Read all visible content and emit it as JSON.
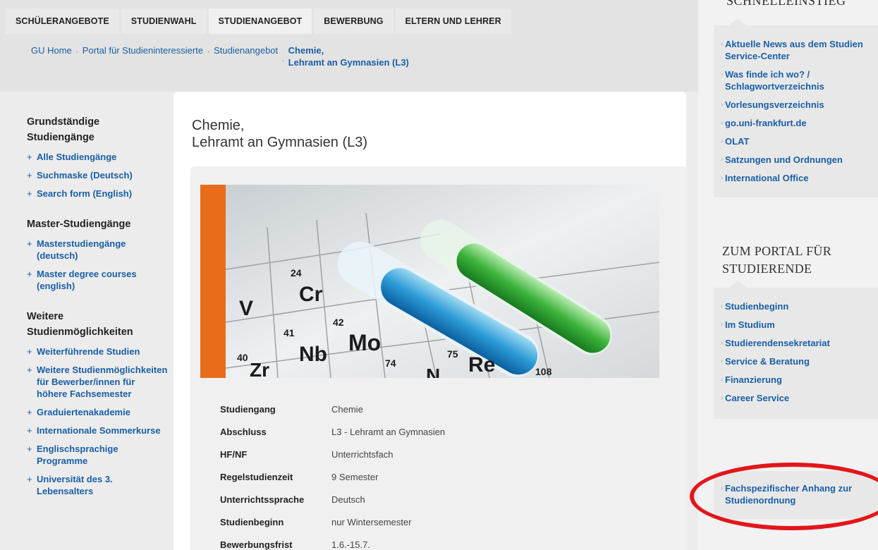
{
  "nav": {
    "tabs": [
      {
        "label": "SCHÜLERANGEBOTE"
      },
      {
        "label": "STUDIENWAHL"
      },
      {
        "label": "STUDIENANGEBOT"
      },
      {
        "label": "BEWERBUNG"
      },
      {
        "label": "ELTERN UND LEHRER"
      }
    ]
  },
  "breadcrumb": {
    "items": [
      "GU Home",
      "Portal für Studieninteressierte",
      "Studienangebot"
    ],
    "current_line1": "Chemie,",
    "current_line2": "Lehramt an Gymnasien (L3)"
  },
  "sidebar": {
    "section1": {
      "heading_line1": "Grundständige",
      "heading_line2": "Studiengänge",
      "items": [
        "Alle Studiengänge",
        "Suchmaske (Deutsch)",
        "Search form (English)"
      ]
    },
    "section2": {
      "heading": "Master-Studiengänge",
      "items": [
        "Masterstudiengänge (deutsch)",
        "Master degree courses (english)"
      ]
    },
    "section3": {
      "heading_line1": "Weitere",
      "heading_line2": "Studienmöglichkeiten",
      "items": [
        "Weiterführende Studien",
        "Weitere Studienmöglichkeiten für Bewerber/innen für höhere Fachsemester",
        "Graduiertenakademie",
        "Internationale Sommerkurse",
        "Englischsprachige Programme",
        "Universität des 3. Lebensalters"
      ]
    }
  },
  "content": {
    "title_line1": "Chemie,",
    "title_line2": "Lehramt an Gymnasien (L3)",
    "facts": [
      {
        "label": "Studiengang",
        "value": "Chemie"
      },
      {
        "label": "Abschluss",
        "value": "L3 - Lehramt an Gymnasien"
      },
      {
        "label": "HF/NF",
        "value": "Unterrichtsfach"
      },
      {
        "label": "Regelstudienzeit",
        "value": "9 Semester"
      },
      {
        "label": "Unterrichtssprache",
        "value": "Deutsch"
      },
      {
        "label": "Studienbeginn",
        "value": "nur Wintersemester"
      },
      {
        "label": "Bewerbungsfrist",
        "value": "1.6.-15.7."
      }
    ],
    "periodic_symbols": [
      "V",
      "Cr",
      "Nb",
      "Mo",
      "Zr",
      "Re",
      "N",
      "24",
      "42",
      "41",
      "40",
      "74",
      "75",
      "108"
    ]
  },
  "right": {
    "top_heading": "SCHNELLEINSTIEG",
    "quick_links": [
      "Aktuelle News aus dem Studien Service-Center",
      "Was finde ich wo? / Schlagwortverzeichnis",
      "Vorlesungsverzeichnis",
      "go.uni-frankfurt.de",
      "OLAT",
      "Satzungen und Ordnungen",
      "International Office"
    ],
    "portal_heading_line1": "ZUM PORTAL FÜR",
    "portal_heading_line2": "STUDIERENDE",
    "portal_links": [
      "Studienbeginn",
      "Im Studium",
      "Studierendensekretariat",
      "Service & Beratung",
      "Finanzierung",
      "Career Service"
    ],
    "bottom_link": "Fachspezifischer Anhang zur Studienordnung"
  },
  "colors": {
    "link": "#1a5fa5",
    "accent_orange": "#e86c1a",
    "highlight_red": "#e3161b"
  }
}
